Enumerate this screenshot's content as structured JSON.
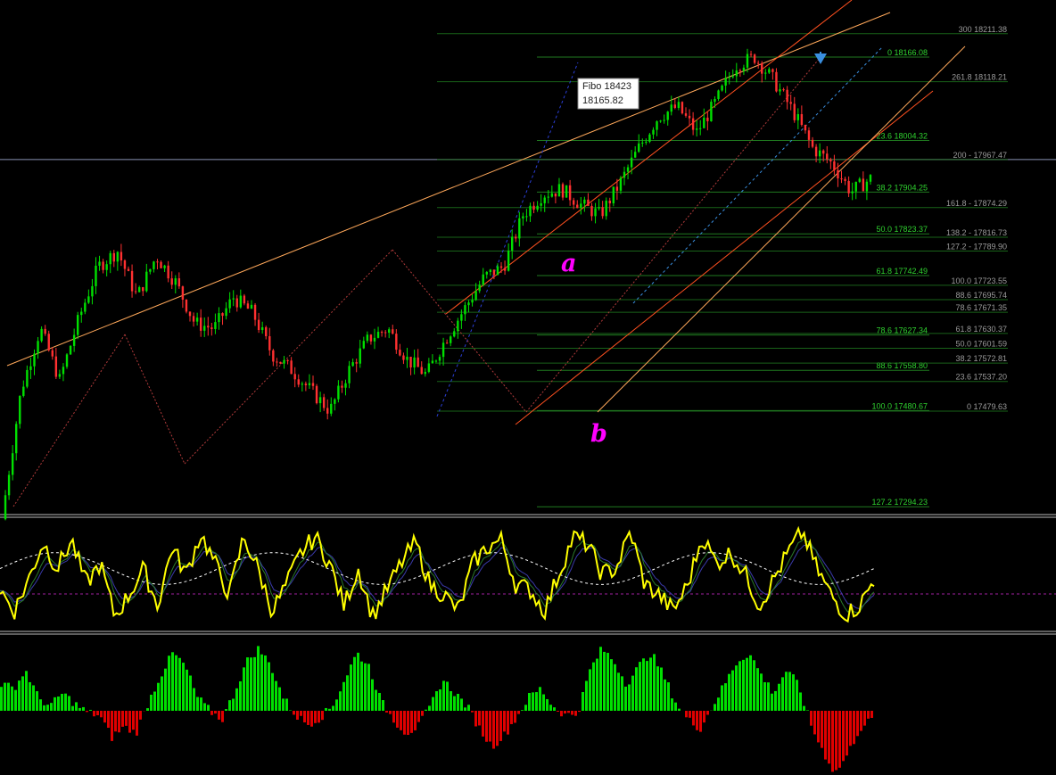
{
  "colors": {
    "background": "#000000",
    "bull_candle": "#00e000",
    "bear_candle": "#ff3030",
    "fib_line_green": "#1f7a1f",
    "fib_text_green": "#2fd22f",
    "fib_text_gray": "#9a9a9a",
    "trend_orange": "#ffa85a",
    "channel_red": "#ff5020",
    "wave_label": "#ff00ff",
    "stoch_main": "#ffff00",
    "stoch_signal": "#ffffff",
    "hist_pos": "#00e000",
    "hist_neg": "#e00000",
    "arrow": "#3a8fe0"
  },
  "chart_data": {
    "type": "candlestick",
    "instrument_price_range": [
      17200,
      18300
    ],
    "current_price_line": 17967.47,
    "fibo_tooltip": {
      "line1": "Fibo 18423",
      "line2": "18165.82"
    },
    "wave_labels": [
      {
        "text": "a"
      },
      {
        "text": "b"
      }
    ],
    "fib_levels_left": [
      {
        "label": "0 18166.08",
        "price": 18166.08,
        "green": true
      },
      {
        "label": "23.6 18004.32",
        "price": 18004.32,
        "green": true
      },
      {
        "label": "38.2 17904.25",
        "price": 17904.25,
        "green": true
      },
      {
        "label": "50.0 17823.37",
        "price": 17823.37,
        "green": true
      },
      {
        "label": "61.8 17742.49",
        "price": 17742.49,
        "green": true
      },
      {
        "label": "78.6 17627.34",
        "price": 17627.34,
        "green": true
      },
      {
        "label": "88.6 17558.80",
        "price": 17558.8,
        "green": true
      },
      {
        "label": "100.0 17480.67",
        "price": 17480.67,
        "green": true
      },
      {
        "label": "127.2 17294.23",
        "price": 17294.23,
        "green": true
      }
    ],
    "fib_levels_right": [
      {
        "label": "300 18211.38",
        "price": 18211.38
      },
      {
        "label": "261.8 18118.21",
        "price": 18118.21
      },
      {
        "label": "200 - 17967.47",
        "price": 17967.47
      },
      {
        "label": "161.8 - 17874.29",
        "price": 17874.29
      },
      {
        "label": "138.2 - 17816.73",
        "price": 17816.73
      },
      {
        "label": "127.2 - 17789.90",
        "price": 17789.9
      },
      {
        "label": "100.0 17723.55",
        "price": 17723.55
      },
      {
        "label": "88.6 17695.74",
        "price": 17695.74
      },
      {
        "label": "78.6 17671.35",
        "price": 17671.35
      },
      {
        "label": "61.8 17630.37",
        "price": 17630.37
      },
      {
        "label": "50.0 17601.59",
        "price": 17601.59
      },
      {
        "label": "38.2 17572.81",
        "price": 17572.81
      },
      {
        "label": "23.6 17537.20",
        "price": 17537.2
      },
      {
        "label": "0 17479.63",
        "price": 17479.63
      }
    ],
    "swing_path": [
      17270,
      17520,
      17640,
      17540,
      17660,
      17760,
      17790,
      17700,
      17780,
      17730,
      17650,
      17640,
      17700,
      17670,
      17590,
      17560,
      17520,
      17480,
      17560,
      17620,
      17640,
      17580,
      17550,
      17620,
      17680,
      17740,
      17760,
      17860,
      17900,
      17910,
      17880,
      17860,
      17920,
      17990,
      18050,
      18070,
      18020,
      18080,
      18150,
      18166,
      18120,
      18060,
      17990,
      17960,
      17905,
      17930
    ],
    "stochastic_path": [
      35,
      15,
      45,
      80,
      55,
      82,
      40,
      60,
      10,
      30,
      55,
      20,
      75,
      50,
      88,
      60,
      30,
      85,
      55,
      15,
      40,
      70,
      85,
      60,
      20,
      55,
      10,
      35,
      60,
      80,
      40,
      30,
      15,
      60,
      75,
      82,
      40,
      35,
      15,
      50,
      85,
      78,
      50,
      55,
      90,
      40,
      30,
      15,
      40,
      85,
      60,
      70,
      50,
      20,
      45,
      70,
      90,
      55,
      30,
      12,
      20,
      45
    ],
    "histogram_path": [
      30,
      25,
      45,
      15,
      5,
      20,
      8,
      -2,
      -5,
      -30,
      -18,
      -25,
      10,
      40,
      65,
      50,
      15,
      0,
      -10,
      20,
      55,
      70,
      50,
      15,
      -5,
      -15,
      -8,
      5,
      35,
      65,
      50,
      10,
      -10,
      -25,
      -18,
      5,
      35,
      20,
      5,
      -20,
      -40,
      -28,
      -8,
      15,
      25,
      5,
      -5,
      -3,
      45,
      70,
      55,
      30,
      50,
      65,
      40,
      10,
      -10,
      -20,
      5,
      30,
      55,
      65,
      40,
      20,
      45,
      30,
      -15,
      -45,
      -70,
      -50,
      -20,
      -10
    ]
  }
}
